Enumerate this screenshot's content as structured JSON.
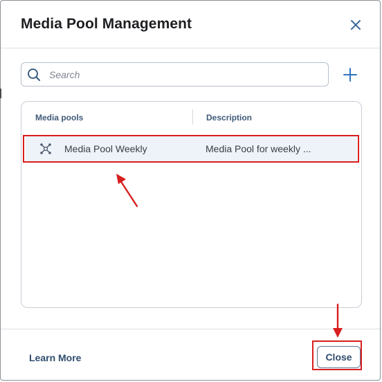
{
  "dialog": {
    "title": "Media Pool Management",
    "close_icon": "close-icon"
  },
  "search": {
    "placeholder": "Search",
    "value": "",
    "icon": "search-icon"
  },
  "toolbar": {
    "add_icon": "plus-icon"
  },
  "table": {
    "columns": [
      "Media pools",
      "Description"
    ],
    "rows": [
      {
        "icon": "media-pool-icon",
        "name": "Media Pool Weekly",
        "description": "Media Pool for weekly ..."
      }
    ]
  },
  "footer": {
    "learn_more_label": "Learn More",
    "close_label": "Close"
  },
  "annotations": {
    "highlight_color": "#d81e1e"
  }
}
